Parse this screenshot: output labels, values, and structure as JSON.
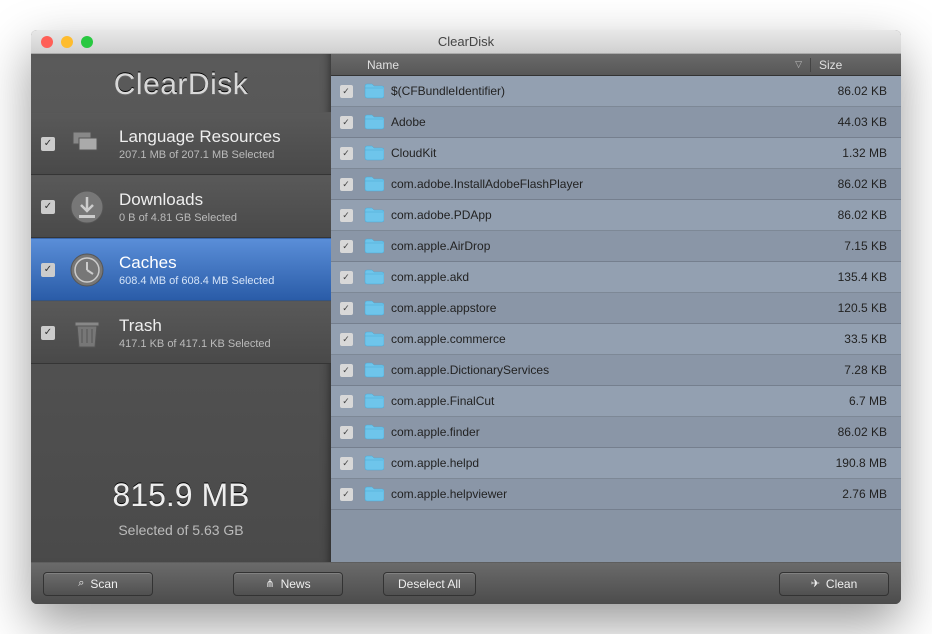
{
  "window": {
    "title": "ClearDisk"
  },
  "brand": "ClearDisk",
  "categories": [
    {
      "name": "Language Resources",
      "sub": "207.1 MB of 207.1 MB Selected",
      "selected": false,
      "icon": "flags"
    },
    {
      "name": "Downloads",
      "sub": "0 B of 4.81 GB Selected",
      "selected": false,
      "icon": "download"
    },
    {
      "name": "Caches",
      "sub": "608.4 MB of 608.4 MB Selected",
      "selected": true,
      "icon": "clock"
    },
    {
      "name": "Trash",
      "sub": "417.1 KB of 417.1 KB Selected",
      "selected": false,
      "icon": "trash"
    }
  ],
  "totals": {
    "size": "815.9 MB",
    "sub": "Selected of 5.63 GB"
  },
  "table": {
    "headers": {
      "name": "Name",
      "size": "Size"
    },
    "rows": [
      {
        "name": "$(CFBundleIdentifier)",
        "size": "86.02 KB"
      },
      {
        "name": "Adobe",
        "size": "44.03 KB"
      },
      {
        "name": "CloudKit",
        "size": "1.32 MB"
      },
      {
        "name": "com.adobe.InstallAdobeFlashPlayer",
        "size": "86.02 KB"
      },
      {
        "name": "com.adobe.PDApp",
        "size": "86.02 KB"
      },
      {
        "name": "com.apple.AirDrop",
        "size": "7.15 KB"
      },
      {
        "name": "com.apple.akd",
        "size": "135.4 KB"
      },
      {
        "name": "com.apple.appstore",
        "size": "120.5 KB"
      },
      {
        "name": "com.apple.commerce",
        "size": "33.5 KB"
      },
      {
        "name": "com.apple.DictionaryServices",
        "size": "7.28 KB"
      },
      {
        "name": "com.apple.FinalCut",
        "size": "6.7 MB"
      },
      {
        "name": "com.apple.finder",
        "size": "86.02 KB"
      },
      {
        "name": "com.apple.helpd",
        "size": "190.8 MB"
      },
      {
        "name": "com.apple.helpviewer",
        "size": "2.76 MB"
      }
    ]
  },
  "footer": {
    "scan": "Scan",
    "news": "News",
    "deselect": "Deselect All",
    "clean": "Clean"
  }
}
